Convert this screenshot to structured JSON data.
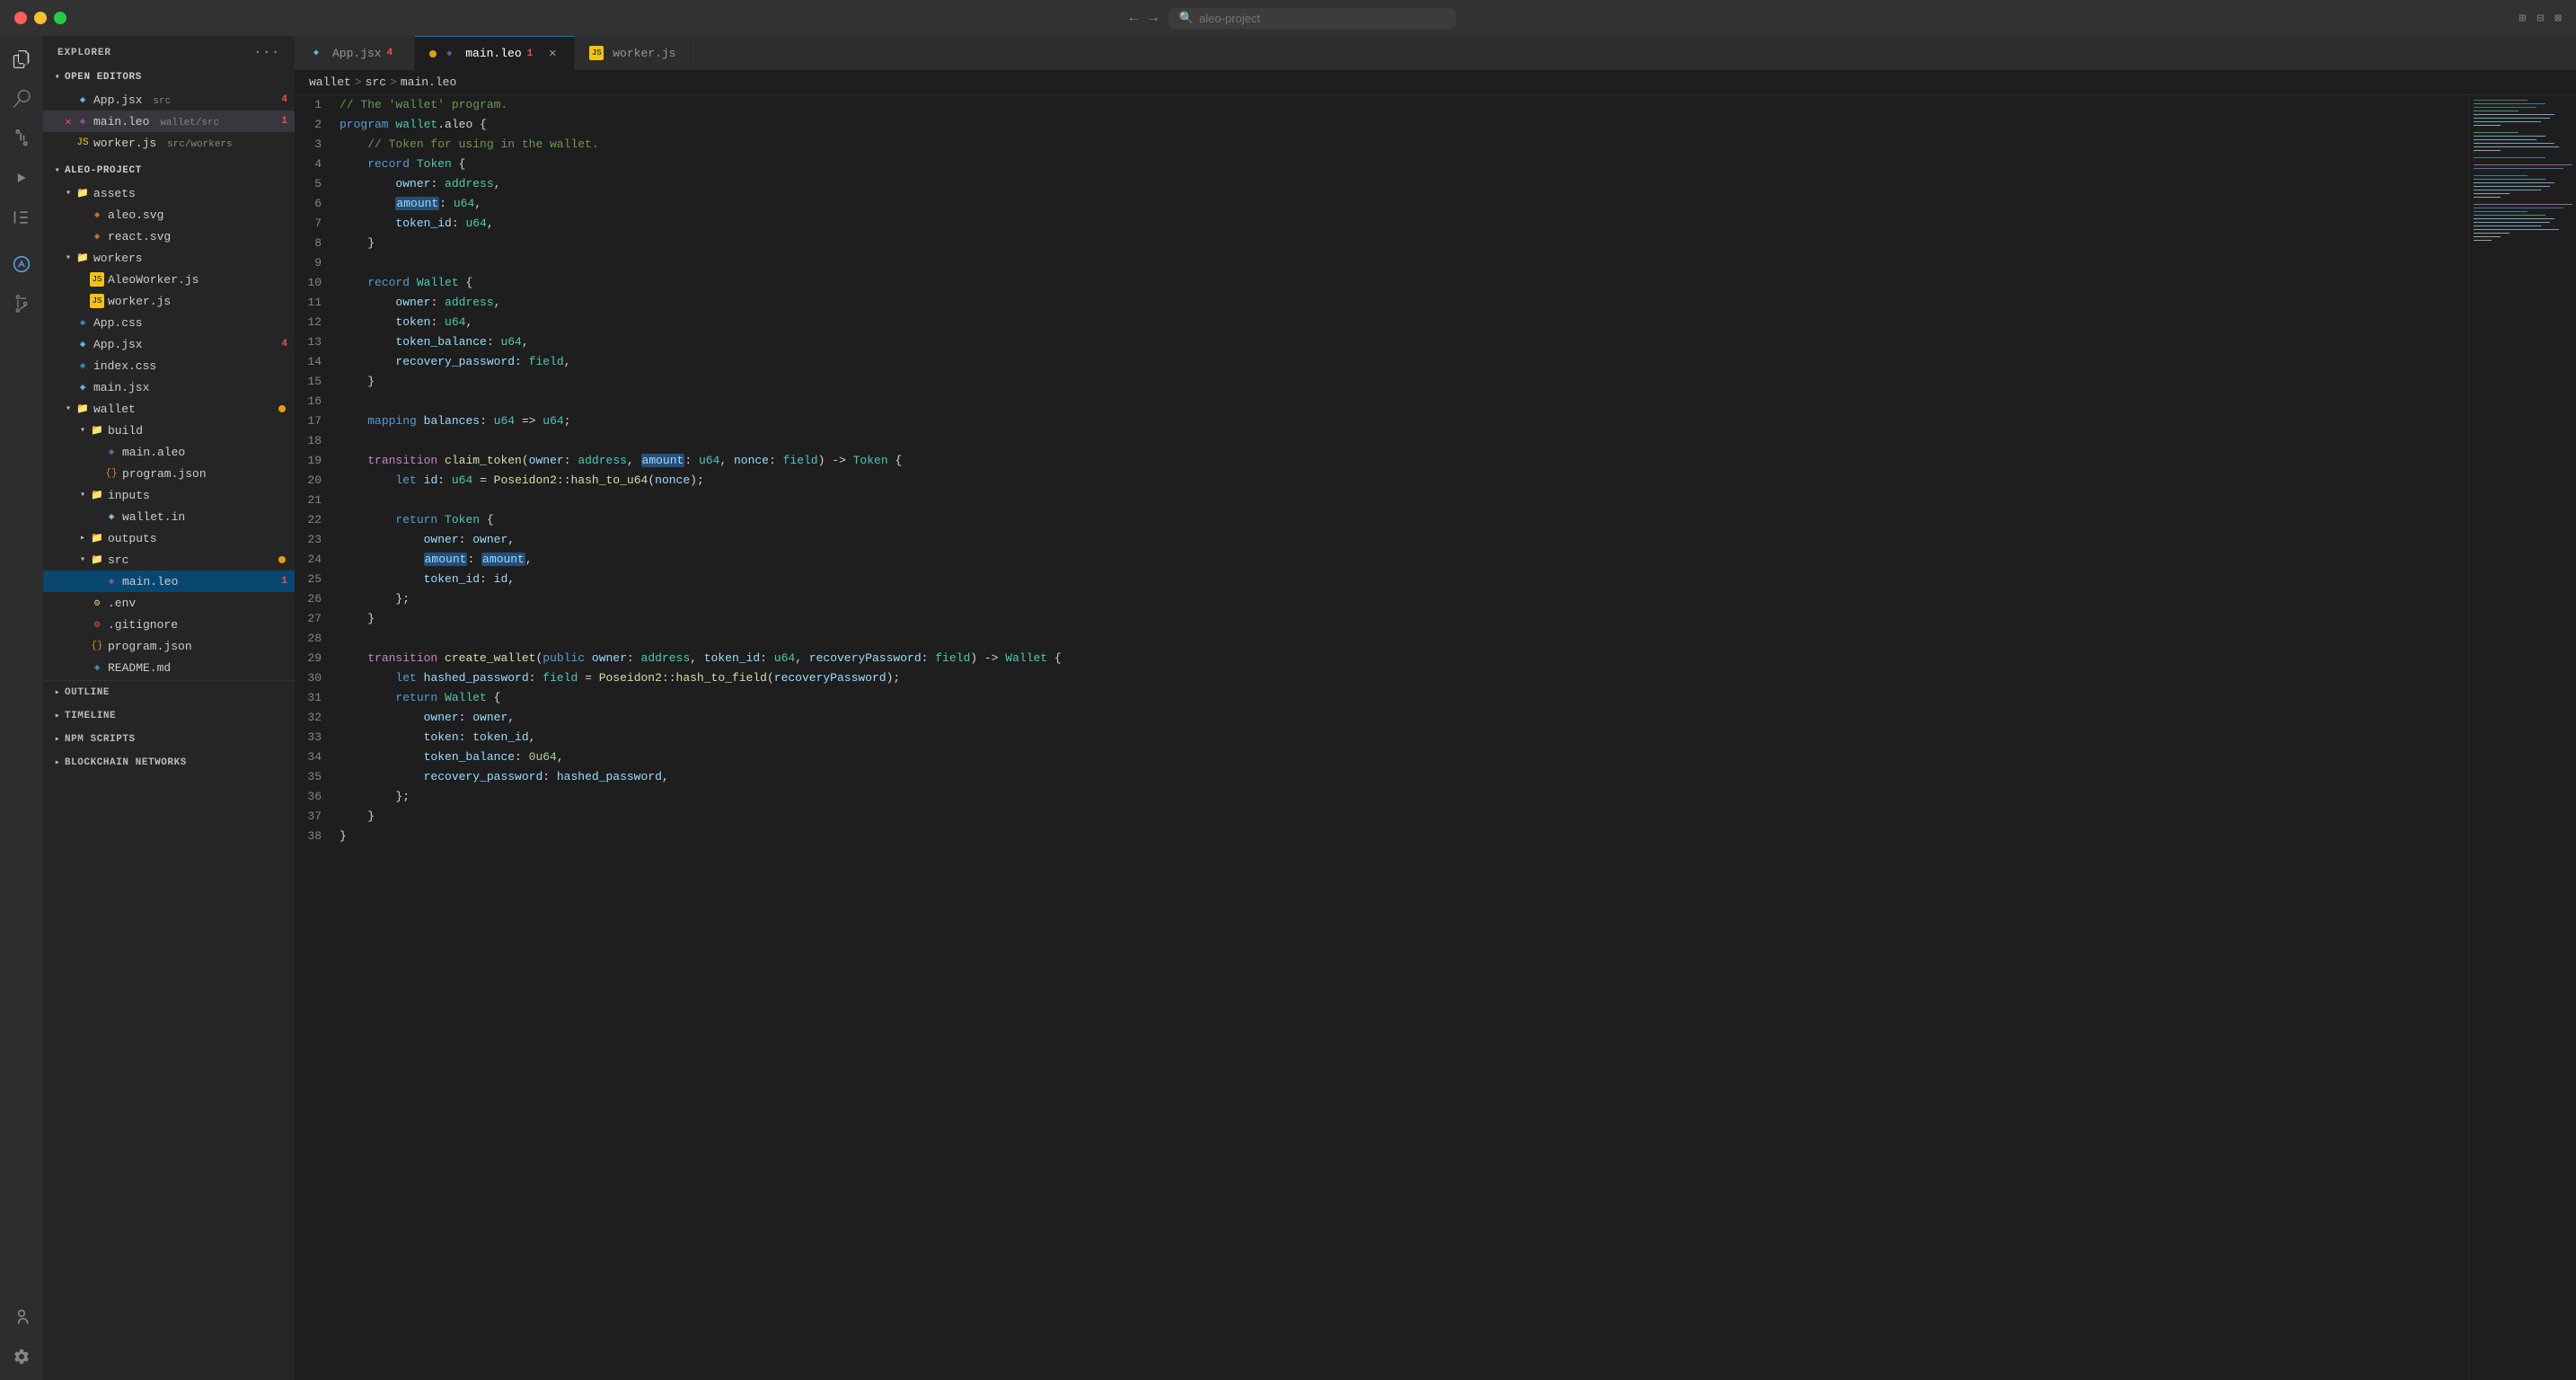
{
  "titlebar": {
    "search_placeholder": "aleo-project",
    "nav_back": "←",
    "nav_forward": "→"
  },
  "tabs": [
    {
      "id": "app-jsx",
      "label": "App.jsx",
      "icon": "jsx",
      "badge": "4",
      "active": false,
      "dirty": false
    },
    {
      "id": "main-leo",
      "label": "main.leo",
      "icon": "leo",
      "badge": "1",
      "active": true,
      "dirty": true
    },
    {
      "id": "worker-js",
      "label": "worker.js",
      "icon": "js",
      "badge": null,
      "active": false,
      "dirty": false
    }
  ],
  "breadcrumb": {
    "parts": [
      "wallet",
      ">",
      "src",
      ">",
      "main.leo"
    ]
  },
  "sidebar": {
    "title": "EXPLORER",
    "sections": {
      "open_editors": "OPEN EDITORS",
      "project": "ALEO-PROJECT",
      "outline": "OUTLINE",
      "timeline": "TIMELINE",
      "npm_scripts": "NPM SCRIPTS",
      "blockchain": "BLOCKCHAIN NETWORKS"
    },
    "open_files": [
      {
        "name": "App.jsx",
        "path": "src",
        "icon": "jsx",
        "badge": "4"
      },
      {
        "name": "main.leo",
        "path": "wallet/src",
        "icon": "leo",
        "badge": "1",
        "dirty": true
      },
      {
        "name": "worker.js",
        "path": "src/workers",
        "icon": "js"
      }
    ],
    "tree": {
      "assets": {
        "files": [
          "aleo.svg",
          "react.svg"
        ]
      },
      "workers": {
        "files": [
          "AleoWorker.js",
          "worker.js"
        ]
      },
      "root_files": [
        "App.css",
        "App.jsx",
        "index.css",
        "main.jsx"
      ],
      "wallet": {
        "build": {
          "files": [
            "main.aleo",
            "program.json"
          ]
        },
        "inputs": {
          "files": [
            "wallet.in"
          ]
        },
        "outputs": {},
        "src": {
          "files": [
            "main.leo"
          ]
        },
        "root_files": [
          ".env",
          ".gitignore",
          "program.json",
          "README.md"
        ]
      }
    }
  },
  "code": {
    "lines": [
      {
        "num": 1,
        "tokens": [
          {
            "t": "comment",
            "v": "// The 'wallet' program."
          }
        ]
      },
      {
        "num": 2,
        "tokens": [
          {
            "t": "keyword",
            "v": "program"
          },
          {
            "t": "plain",
            "v": " "
          },
          {
            "t": "walletname",
            "v": "wallet"
          },
          {
            "t": "plain",
            "v": ".aleo {"
          }
        ]
      },
      {
        "num": 3,
        "tokens": [
          {
            "t": "plain",
            "v": "    "
          },
          {
            "t": "comment",
            "v": "// Token for using in the wallet."
          }
        ]
      },
      {
        "num": 4,
        "tokens": [
          {
            "t": "plain",
            "v": "    "
          },
          {
            "t": "keyword",
            "v": "record"
          },
          {
            "t": "plain",
            "v": " "
          },
          {
            "t": "type",
            "v": "Token"
          },
          {
            "t": "plain",
            "v": " {"
          }
        ]
      },
      {
        "num": 5,
        "tokens": [
          {
            "t": "plain",
            "v": "        "
          },
          {
            "t": "prop",
            "v": "owner"
          },
          {
            "t": "plain",
            "v": ": "
          },
          {
            "t": "type",
            "v": "address"
          },
          {
            "t": "plain",
            "v": ","
          }
        ]
      },
      {
        "num": 6,
        "tokens": [
          {
            "t": "plain",
            "v": "        "
          },
          {
            "t": "highlight",
            "v": "amount"
          },
          {
            "t": "plain",
            "v": ": "
          },
          {
            "t": "type",
            "v": "u64"
          },
          {
            "t": "plain",
            "v": ","
          }
        ]
      },
      {
        "num": 7,
        "tokens": [
          {
            "t": "plain",
            "v": "        "
          },
          {
            "t": "prop",
            "v": "token_id"
          },
          {
            "t": "plain",
            "v": ": "
          },
          {
            "t": "type",
            "v": "u64"
          },
          {
            "t": "plain",
            "v": ","
          }
        ]
      },
      {
        "num": 8,
        "tokens": [
          {
            "t": "plain",
            "v": "    }"
          }
        ]
      },
      {
        "num": 9,
        "tokens": []
      },
      {
        "num": 10,
        "tokens": [
          {
            "t": "plain",
            "v": "    "
          },
          {
            "t": "keyword",
            "v": "record"
          },
          {
            "t": "plain",
            "v": " "
          },
          {
            "t": "type",
            "v": "Wallet"
          },
          {
            "t": "plain",
            "v": " {"
          }
        ]
      },
      {
        "num": 11,
        "tokens": [
          {
            "t": "plain",
            "v": "        "
          },
          {
            "t": "prop",
            "v": "owner"
          },
          {
            "t": "plain",
            "v": ": "
          },
          {
            "t": "type",
            "v": "address"
          },
          {
            "t": "plain",
            "v": ","
          }
        ]
      },
      {
        "num": 12,
        "tokens": [
          {
            "t": "plain",
            "v": "        "
          },
          {
            "t": "prop",
            "v": "token"
          },
          {
            "t": "plain",
            "v": ": "
          },
          {
            "t": "type",
            "v": "u64"
          },
          {
            "t": "plain",
            "v": ","
          }
        ]
      },
      {
        "num": 13,
        "tokens": [
          {
            "t": "plain",
            "v": "        "
          },
          {
            "t": "prop",
            "v": "token_balance"
          },
          {
            "t": "plain",
            "v": ": "
          },
          {
            "t": "type",
            "v": "u64"
          },
          {
            "t": "plain",
            "v": ","
          }
        ]
      },
      {
        "num": 14,
        "tokens": [
          {
            "t": "plain",
            "v": "        "
          },
          {
            "t": "prop",
            "v": "recovery_password"
          },
          {
            "t": "plain",
            "v": ": "
          },
          {
            "t": "type",
            "v": "field"
          },
          {
            "t": "plain",
            "v": ","
          }
        ]
      },
      {
        "num": 15,
        "tokens": [
          {
            "t": "plain",
            "v": "    }"
          }
        ]
      },
      {
        "num": 16,
        "tokens": []
      },
      {
        "num": 17,
        "tokens": [
          {
            "t": "plain",
            "v": "    "
          },
          {
            "t": "keyword",
            "v": "mapping"
          },
          {
            "t": "plain",
            "v": " "
          },
          {
            "t": "var",
            "v": "balances"
          },
          {
            "t": "plain",
            "v": ": "
          },
          {
            "t": "type",
            "v": "u64"
          },
          {
            "t": "plain",
            "v": " => "
          },
          {
            "t": "type",
            "v": "u64"
          },
          {
            "t": "plain",
            "v": ";"
          }
        ]
      },
      {
        "num": 18,
        "tokens": []
      },
      {
        "num": 19,
        "tokens": [
          {
            "t": "plain",
            "v": "    "
          },
          {
            "t": "transition",
            "v": "transition"
          },
          {
            "t": "plain",
            "v": " "
          },
          {
            "t": "func",
            "v": "claim_token"
          },
          {
            "t": "plain",
            "v": "("
          },
          {
            "t": "prop",
            "v": "owner"
          },
          {
            "t": "plain",
            "v": ": "
          },
          {
            "t": "type",
            "v": "address"
          },
          {
            "t": "plain",
            "v": ", "
          },
          {
            "t": "highlight",
            "v": "amount"
          },
          {
            "t": "plain",
            "v": ": "
          },
          {
            "t": "type",
            "v": "u64"
          },
          {
            "t": "plain",
            "v": ", "
          },
          {
            "t": "prop",
            "v": "nonce"
          },
          {
            "t": "plain",
            "v": ": "
          },
          {
            "t": "type",
            "v": "field"
          },
          {
            "t": "plain",
            "v": ") -> "
          },
          {
            "t": "type",
            "v": "Token"
          },
          {
            "t": "plain",
            "v": " {"
          }
        ]
      },
      {
        "num": 20,
        "tokens": [
          {
            "t": "plain",
            "v": "        "
          },
          {
            "t": "keyword",
            "v": "let"
          },
          {
            "t": "plain",
            "v": " "
          },
          {
            "t": "var",
            "v": "id"
          },
          {
            "t": "plain",
            "v": ": "
          },
          {
            "t": "type",
            "v": "u64"
          },
          {
            "t": "plain",
            "v": " = "
          },
          {
            "t": "func",
            "v": "Poseidon2"
          },
          {
            "t": "plain",
            "v": "::"
          },
          {
            "t": "func",
            "v": "hash_to_u64"
          },
          {
            "t": "plain",
            "v": "("
          },
          {
            "t": "var",
            "v": "nonce"
          },
          {
            "t": "plain",
            "v": ");"
          }
        ]
      },
      {
        "num": 21,
        "tokens": []
      },
      {
        "num": 22,
        "tokens": [
          {
            "t": "plain",
            "v": "        "
          },
          {
            "t": "keyword",
            "v": "return"
          },
          {
            "t": "plain",
            "v": " "
          },
          {
            "t": "type",
            "v": "Token"
          },
          {
            "t": "plain",
            "v": " {"
          }
        ]
      },
      {
        "num": 23,
        "tokens": [
          {
            "t": "plain",
            "v": "            "
          },
          {
            "t": "prop",
            "v": "owner"
          },
          {
            "t": "plain",
            "v": ": "
          },
          {
            "t": "var",
            "v": "owner"
          },
          {
            "t": "plain",
            "v": ","
          }
        ]
      },
      {
        "num": 24,
        "tokens": [
          {
            "t": "plain",
            "v": "            "
          },
          {
            "t": "highlight",
            "v": "amount"
          },
          {
            "t": "plain",
            "v": ": "
          },
          {
            "t": "highlight",
            "v": "amount"
          },
          {
            "t": "plain",
            "v": ","
          }
        ]
      },
      {
        "num": 25,
        "tokens": [
          {
            "t": "plain",
            "v": "            "
          },
          {
            "t": "prop",
            "v": "token_id"
          },
          {
            "t": "plain",
            "v": ": "
          },
          {
            "t": "var",
            "v": "id"
          },
          {
            "t": "plain",
            "v": ","
          }
        ]
      },
      {
        "num": 26,
        "tokens": [
          {
            "t": "plain",
            "v": "        };"
          }
        ]
      },
      {
        "num": 27,
        "tokens": [
          {
            "t": "plain",
            "v": "    }"
          }
        ]
      },
      {
        "num": 28,
        "tokens": []
      },
      {
        "num": 29,
        "tokens": [
          {
            "t": "plain",
            "v": "    "
          },
          {
            "t": "transition",
            "v": "transition"
          },
          {
            "t": "plain",
            "v": " "
          },
          {
            "t": "func",
            "v": "create_wallet"
          },
          {
            "t": "plain",
            "v": "("
          },
          {
            "t": "keyword",
            "v": "public"
          },
          {
            "t": "plain",
            "v": " "
          },
          {
            "t": "prop",
            "v": "owner"
          },
          {
            "t": "plain",
            "v": ": "
          },
          {
            "t": "type",
            "v": "address"
          },
          {
            "t": "plain",
            "v": ", "
          },
          {
            "t": "prop",
            "v": "token_id"
          },
          {
            "t": "plain",
            "v": ": "
          },
          {
            "t": "type",
            "v": "u64"
          },
          {
            "t": "plain",
            "v": ", "
          },
          {
            "t": "prop",
            "v": "recoveryPassword"
          },
          {
            "t": "plain",
            "v": ": "
          },
          {
            "t": "type",
            "v": "field"
          },
          {
            "t": "plain",
            "v": ") -> "
          },
          {
            "t": "type",
            "v": "Wallet"
          },
          {
            "t": "plain",
            "v": " {"
          }
        ]
      },
      {
        "num": 30,
        "tokens": [
          {
            "t": "plain",
            "v": "        "
          },
          {
            "t": "keyword",
            "v": "let"
          },
          {
            "t": "plain",
            "v": " "
          },
          {
            "t": "var",
            "v": "hashed_password"
          },
          {
            "t": "plain",
            "v": ": "
          },
          {
            "t": "type",
            "v": "field"
          },
          {
            "t": "plain",
            "v": " = "
          },
          {
            "t": "func",
            "v": "Poseidon2"
          },
          {
            "t": "plain",
            "v": "::"
          },
          {
            "t": "func",
            "v": "hash_to_field"
          },
          {
            "t": "plain",
            "v": "("
          },
          {
            "t": "var",
            "v": "recoveryPassword"
          },
          {
            "t": "plain",
            "v": ");"
          }
        ]
      },
      {
        "num": 31,
        "tokens": [
          {
            "t": "plain",
            "v": "        "
          },
          {
            "t": "keyword",
            "v": "return"
          },
          {
            "t": "plain",
            "v": " "
          },
          {
            "t": "type",
            "v": "Wallet"
          },
          {
            "t": "plain",
            "v": " {"
          }
        ]
      },
      {
        "num": 32,
        "tokens": [
          {
            "t": "plain",
            "v": "            "
          },
          {
            "t": "prop",
            "v": "owner"
          },
          {
            "t": "plain",
            "v": ": "
          },
          {
            "t": "var",
            "v": "owner"
          },
          {
            "t": "plain",
            "v": ","
          }
        ]
      },
      {
        "num": 33,
        "tokens": [
          {
            "t": "plain",
            "v": "            "
          },
          {
            "t": "prop",
            "v": "token"
          },
          {
            "t": "plain",
            "v": ": "
          },
          {
            "t": "var",
            "v": "token_id"
          },
          {
            "t": "plain",
            "v": ","
          }
        ]
      },
      {
        "num": 34,
        "tokens": [
          {
            "t": "plain",
            "v": "            "
          },
          {
            "t": "prop",
            "v": "token_balance"
          },
          {
            "t": "plain",
            "v": ": "
          },
          {
            "t": "number",
            "v": "0u64"
          },
          {
            "t": "plain",
            "v": ","
          }
        ]
      },
      {
        "num": 35,
        "tokens": [
          {
            "t": "plain",
            "v": "            "
          },
          {
            "t": "prop",
            "v": "recovery_password"
          },
          {
            "t": "plain",
            "v": ": "
          },
          {
            "t": "var",
            "v": "hashed_password"
          },
          {
            "t": "plain",
            "v": ","
          }
        ]
      },
      {
        "num": 36,
        "tokens": [
          {
            "t": "plain",
            "v": "        };"
          }
        ]
      },
      {
        "num": 37,
        "tokens": [
          {
            "t": "plain",
            "v": "    }"
          }
        ]
      },
      {
        "num": 38,
        "tokens": [
          {
            "t": "plain",
            "v": "}"
          }
        ]
      }
    ]
  }
}
